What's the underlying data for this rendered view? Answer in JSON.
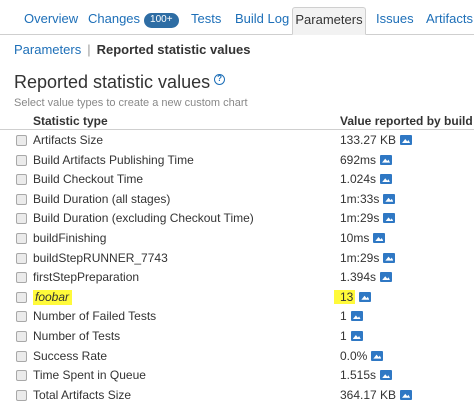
{
  "tabs": [
    {
      "label": "Overview"
    },
    {
      "label": "Changes",
      "badge": "100+"
    },
    {
      "label": "Tests"
    },
    {
      "label": "Build Log"
    },
    {
      "label": "Parameters",
      "active": true
    },
    {
      "label": "Issues"
    },
    {
      "label": "Artifacts"
    }
  ],
  "breadcrumb": {
    "parent": "Parameters",
    "separator": "|",
    "current": "Reported statistic values"
  },
  "page": {
    "title": "Reported statistic values",
    "help_icon": "question-circle-icon",
    "subtitle": "Select value types to create a new custom chart"
  },
  "table": {
    "headers": {
      "type": "Statistic type",
      "value": "Value reported by build"
    },
    "rows": [
      {
        "type": "Artifacts Size",
        "value": "133.27 KB"
      },
      {
        "type": "Build Artifacts Publishing Time",
        "value": "692ms"
      },
      {
        "type": "Build Checkout Time",
        "value": "1.024s"
      },
      {
        "type": "Build Duration (all stages)",
        "value": "1m:33s"
      },
      {
        "type": "Build Duration (excluding Checkout Time)",
        "value": "1m:29s"
      },
      {
        "type": "buildFinishing",
        "value": "10ms"
      },
      {
        "type": "buildStepRUNNER_7743",
        "value": "1m:29s"
      },
      {
        "type": "firstStepPreparation",
        "value": "1.394s"
      },
      {
        "type": "foobar",
        "value": "13",
        "highlighted": true
      },
      {
        "type": "Number of Failed Tests",
        "value": "1"
      },
      {
        "type": "Number of Tests",
        "value": "1"
      },
      {
        "type": "Success Rate",
        "value": "0.0%"
      },
      {
        "type": "Time Spent in Queue",
        "value": "1.515s"
      },
      {
        "type": "Total Artifacts Size",
        "value": "364.17 KB"
      }
    ]
  },
  "icons": {
    "chart": "chart-icon",
    "checkbox": "checkbox"
  },
  "colors": {
    "link": "#1d6fb8",
    "badge": "#2e6da4",
    "highlight": "#fffa3a",
    "chart_icon": "#2f78c4"
  }
}
